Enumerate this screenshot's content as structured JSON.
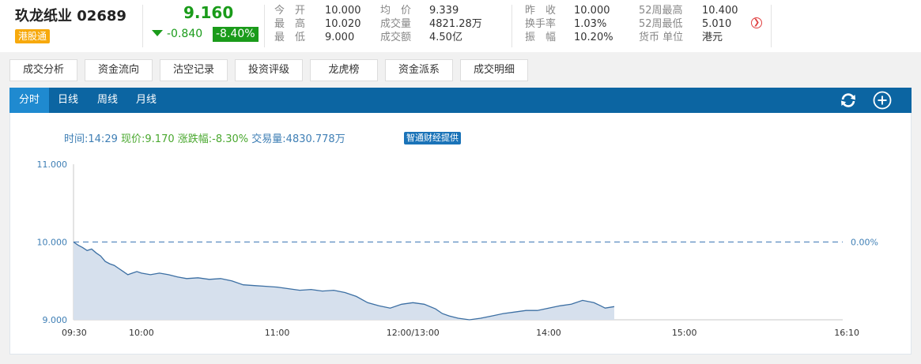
{
  "quote": {
    "name": "玖龙纸业",
    "code": "02689",
    "badge": "港股通",
    "price": "9.160",
    "change": "-0.840",
    "change_pct": "-8.40%",
    "stats": [
      {
        "label": "今　开",
        "value": "10.000"
      },
      {
        "label": "最　高",
        "value": "10.020"
      },
      {
        "label": "最　低",
        "value": "9.000"
      },
      {
        "label": "均　价",
        "value": "9.339"
      },
      {
        "label": "成交量",
        "value": "4821.28万"
      },
      {
        "label": "成交额",
        "value": "4.50亿"
      },
      {
        "label": "昨　收",
        "value": "10.000"
      },
      {
        "label": "换手率",
        "value": "1.03%"
      },
      {
        "label": "振　幅",
        "value": "10.20%"
      },
      {
        "label": "52周最高",
        "value": "10.400"
      },
      {
        "label": "52周最低",
        "value": "5.010"
      },
      {
        "label": "货币 单位",
        "value": "港元"
      }
    ],
    "colors": {
      "down": "#1a9b1a",
      "badge": "#f7a90c"
    }
  },
  "tabs": [
    "成交分析",
    "资金流向",
    "沽空记录",
    "投资评级",
    "龙虎榜",
    "资金派系",
    "成交明细"
  ],
  "period_tabs": [
    {
      "label": "分时",
      "active": true
    },
    {
      "label": "日线",
      "active": false
    },
    {
      "label": "周线",
      "active": false
    },
    {
      "label": "月线",
      "active": false
    }
  ],
  "toolbar_icons": [
    "refresh-icon",
    "add-icon"
  ],
  "info": {
    "time_label": "时间:",
    "time": "14:29",
    "price_label": "现价:",
    "price": "9.170",
    "pct_label": "涨跌幅:",
    "pct": "-8.30%",
    "vol_label": "交易量:",
    "vol": "4830.778万",
    "provider": "智通财经提供"
  },
  "chart_data": {
    "type": "area",
    "title": "",
    "xlabel": "",
    "ylabel": "",
    "y_ticks": [
      "11.000",
      "10.000",
      "9.000"
    ],
    "ylim": [
      9.0,
      11.0
    ],
    "x_ticks": [
      "09:30",
      "10:00",
      "11:00",
      "12:00/13:00",
      "14:00",
      "15:00",
      "16:10"
    ],
    "x_tick_minutes": [
      0,
      30,
      90,
      150,
      210,
      270,
      340
    ],
    "reference_value": 10.0,
    "reference_label": "0.00%",
    "series": [
      {
        "name": "",
        "x_minutes": [
          0,
          2,
          4,
          6,
          8,
          10,
          12,
          14,
          16,
          18,
          20,
          22,
          24,
          26,
          28,
          30,
          34,
          38,
          42,
          46,
          50,
          55,
          60,
          65,
          70,
          75,
          80,
          85,
          90,
          95,
          100,
          105,
          110,
          115,
          120,
          125,
          130,
          135,
          140,
          145,
          150,
          155,
          160,
          163,
          166,
          170,
          175,
          180,
          185,
          190,
          195,
          200,
          205,
          210,
          215,
          220,
          225,
          230,
          233,
          235,
          239
        ],
        "values": [
          10.0,
          9.96,
          9.93,
          9.89,
          9.91,
          9.86,
          9.82,
          9.75,
          9.72,
          9.7,
          9.66,
          9.62,
          9.58,
          9.6,
          9.62,
          9.6,
          9.58,
          9.6,
          9.58,
          9.55,
          9.53,
          9.54,
          9.52,
          9.53,
          9.5,
          9.45,
          9.44,
          9.43,
          9.42,
          9.4,
          9.38,
          9.39,
          9.37,
          9.38,
          9.35,
          9.3,
          9.22,
          9.18,
          9.15,
          9.2,
          9.22,
          9.2,
          9.14,
          9.08,
          9.05,
          9.02,
          9.0,
          9.02,
          9.05,
          9.08,
          9.1,
          9.12,
          9.12,
          9.15,
          9.18,
          9.2,
          9.25,
          9.22,
          9.18,
          9.15,
          9.17
        ]
      }
    ],
    "colors": {
      "line": "#3c6fa3",
      "fill": "#d6e0ed",
      "reference": "#5a8bc0"
    },
    "grid": false
  }
}
